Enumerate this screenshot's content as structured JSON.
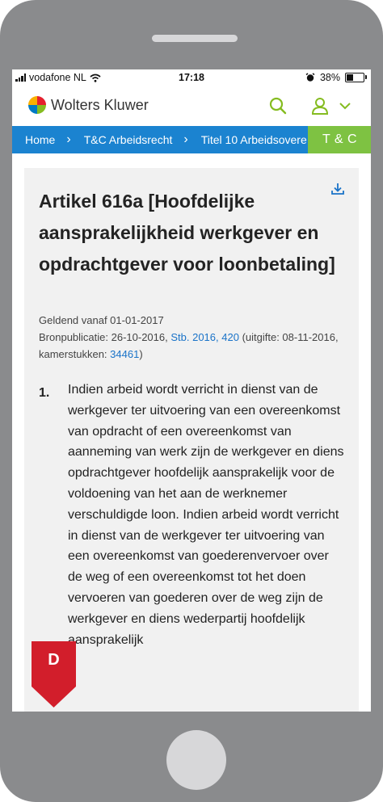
{
  "status_bar": {
    "carrier": "vodafone NL",
    "time": "17:18",
    "battery": "38%"
  },
  "header": {
    "brand": "Wolters Kluwer"
  },
  "breadcrumb": {
    "items": [
      "Home",
      "T&C Arbeidsrecht",
      "Titel 10 Arbeidsovere"
    ],
    "badge": "T & C"
  },
  "article": {
    "title": "Artikel 616a [Hoofdelijke aansprakelijkheid werkgever en opdrachtgever voor loonbetaling]",
    "geldend": "Geldend vanaf 01-01-2017",
    "bron_prefix": "Bronpublicatie: 26-10-2016,",
    "bron_link": "Stb. 2016, 420",
    "bron_mid": "(uitgifte: 08-11-2016, kamerstukken:",
    "kamerstukken_link": "34461",
    "bron_suffix": ")",
    "paragraph_number": "1.",
    "paragraph_text": "Indien arbeid wordt verricht in dienst van de werkgever ter uitvoering van een overeenkomst van opdracht of een overeenkomst van aanneming van werk zijn de werkgever en diens opdrachtgever hoofdelijk aansprakelijk voor de voldoening van het aan de werknemer verschuldigde loon. Indien arbeid wordt verricht in dienst van de werkgever ter uitvoering van een overeenkomst van goederenvervoer over de weg of een overeenkomst tot het doen vervoeren van goederen over de weg zijn de werkgever en diens wederpartij hoofdelijk aansprakelijk"
  },
  "floating": {
    "badge_letter": "D"
  },
  "colors": {
    "breadcrumb": "#1b83d0",
    "tc_badge": "#7ec242",
    "badge_red": "#d21e2b",
    "toc_button": "#4f3e8a",
    "link": "#1a73c8",
    "icon_green": "#85bc20"
  }
}
